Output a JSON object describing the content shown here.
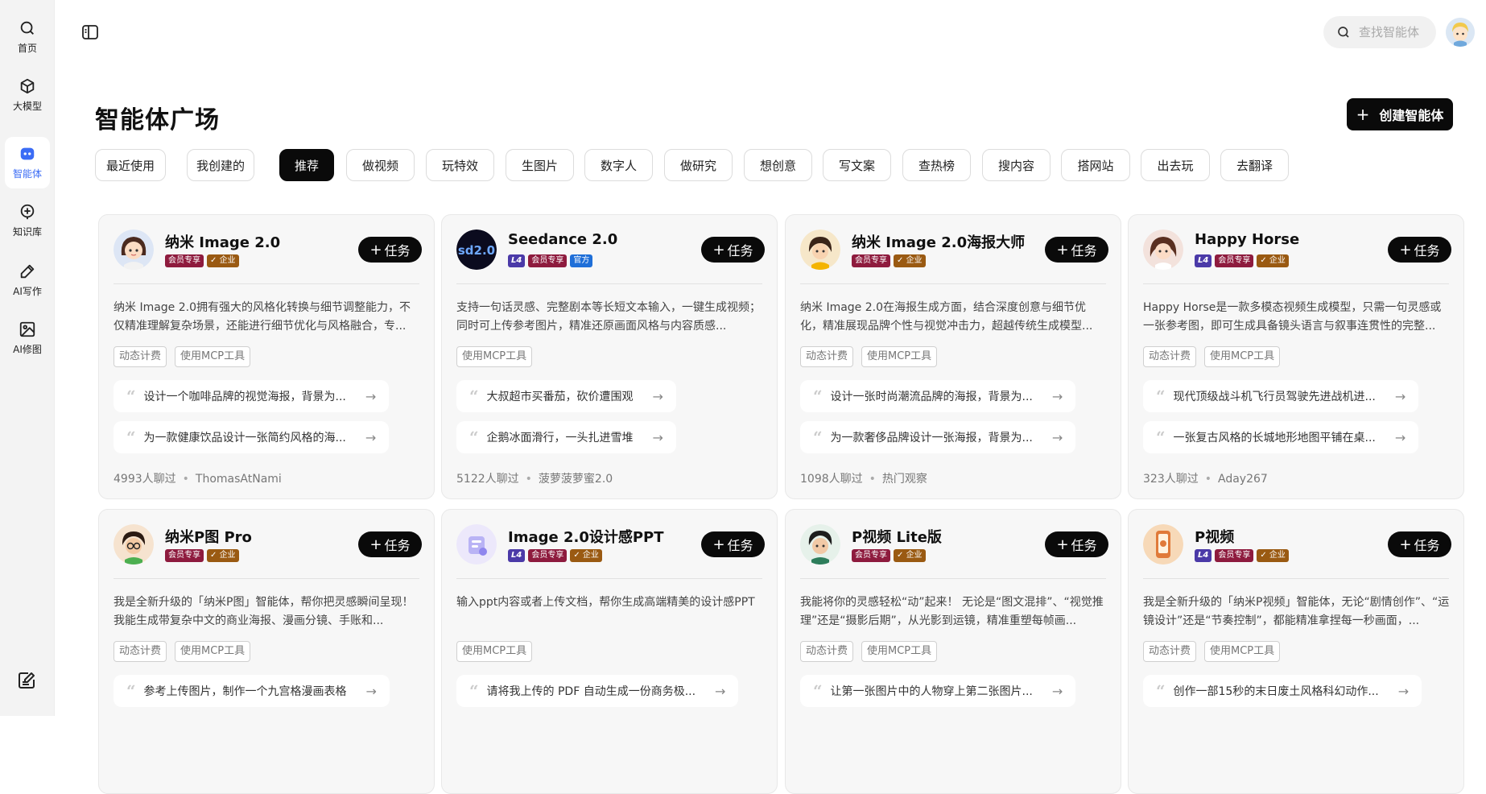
{
  "sidebar": {
    "items": [
      {
        "label": "首页",
        "icon": "search-icon"
      },
      {
        "label": "大模型",
        "icon": "cube-icon"
      },
      {
        "label": "智能体",
        "icon": "agent-icon"
      },
      {
        "label": "知识库",
        "icon": "add-circle-icon"
      },
      {
        "label": "AI写作",
        "icon": "pen-icon"
      },
      {
        "label": "AI修图",
        "icon": "image-icon"
      }
    ],
    "active_index": 2,
    "accent": "#3b6cf5"
  },
  "header": {
    "search_placeholder": "查找智能体"
  },
  "main": {
    "title": "智能体广场",
    "create_label": "创建智能体",
    "tabs": [
      "最近使用",
      "我创建的",
      "推荐",
      "做视频",
      "玩特效",
      "生图片",
      "数字人",
      "做研究",
      "想创意",
      "写文案",
      "查热榜",
      "搜内容",
      "搭网站",
      "出去玩",
      "去翻译"
    ],
    "active_tab": "推荐",
    "task_label": "任务",
    "cards": [
      {
        "name": "纳米 Image 2.0",
        "badges": [
          {
            "type": "vip",
            "text": "会员专享"
          },
          {
            "type": "ent",
            "text": "企业"
          }
        ],
        "desc": "纳米 Image 2.0拥有强大的风格化转换与细节调整能力，不仅精准理解复杂场景，还能进行细节优化与风格融合，专...",
        "tags": [
          "动态计费",
          "使用MCP工具"
        ],
        "prompts": [
          "设计一个咖啡品牌的视觉海报，背景为...",
          "为一款健康饮品设计一张简约风格的海..."
        ],
        "chats": "4993人聊过",
        "author": "ThomasAtNami"
      },
      {
        "name": "Seedance 2.0",
        "badges": [
          {
            "type": "l4",
            "text": "L4"
          },
          {
            "type": "vip",
            "text": "会员专享"
          },
          {
            "type": "off",
            "text": "官方"
          }
        ],
        "desc": "支持一句话灵感、完整剧本等长短文本输入，一键生成视频；同时可上传参考图片，精准还原画面风格与内容质感...",
        "tags": [
          "使用MCP工具"
        ],
        "prompts": [
          "大叔超市买番茄，砍价遭围观",
          "企鹅冰面滑行，一头扎进雪堆"
        ],
        "chats": "5122人聊过",
        "author": "菠萝菠萝蜜2.0"
      },
      {
        "name": "纳米 Image 2.0海报大师",
        "badges": [
          {
            "type": "vip",
            "text": "会员专享"
          },
          {
            "type": "ent",
            "text": "企业"
          }
        ],
        "desc": "纳米 Image 2.0在海报生成方面，结合深度创意与细节优化，精准展现品牌个性与视觉冲击力，超越传统生成模型...",
        "tags": [
          "动态计费",
          "使用MCP工具"
        ],
        "prompts": [
          "设计一张时尚潮流品牌的海报，背景为...",
          "为一款奢侈品牌设计一张海报，背景为..."
        ],
        "chats": "1098人聊过",
        "author": "热门观察"
      },
      {
        "name": "Happy Horse",
        "badges": [
          {
            "type": "l4",
            "text": "L4"
          },
          {
            "type": "vip",
            "text": "会员专享"
          },
          {
            "type": "ent",
            "text": "企业"
          }
        ],
        "desc": "Happy Horse是一款多模态视频生成模型，只需一句灵感或一张参考图，即可生成具备镜头语言与叙事连贯性的完整...",
        "tags": [
          "动态计费",
          "使用MCP工具"
        ],
        "prompts": [
          "现代顶级战斗机飞行员驾驶先进战机进...",
          "一张复古风格的长城地形地图平铺在桌..."
        ],
        "chats": "323人聊过",
        "author": "Aday267"
      },
      {
        "name": "纳米P图 Pro",
        "badges": [
          {
            "type": "vip",
            "text": "会员专享"
          },
          {
            "type": "ent",
            "text": "企业"
          }
        ],
        "desc": "我是全新升级的「纳米P图」智能体，帮你把灵感瞬间呈现！ 我能生成带复杂中文的商业海报、漫画分镜、手账和...",
        "tags": [
          "动态计费",
          "使用MCP工具"
        ],
        "prompts": [
          "参考上传图片，制作一个九宫格漫画表格"
        ],
        "chats": "",
        "author": ""
      },
      {
        "name": "Image 2.0设计感PPT",
        "badges": [
          {
            "type": "l4",
            "text": "L4"
          },
          {
            "type": "vip",
            "text": "会员专享"
          },
          {
            "type": "ent",
            "text": "企业"
          }
        ],
        "desc": "输入ppt内容或者上传文档，帮你生成高端精美的设计感PPT",
        "tags": [
          "使用MCP工具"
        ],
        "prompts": [
          "请将我上传的 PDF 自动生成一份商务极..."
        ],
        "chats": "",
        "author": ""
      },
      {
        "name": "P视频 Lite版",
        "badges": [
          {
            "type": "vip",
            "text": "会员专享"
          },
          {
            "type": "ent",
            "text": "企业"
          }
        ],
        "desc": "我能将你的灵感轻松“动”起来！ 无论是“图文混排”、“视觉推理”还是“摄影后期”，从光影到运镜，精准重塑每帧画...",
        "tags": [
          "动态计费",
          "使用MCP工具"
        ],
        "prompts": [
          "让第一张图片中的人物穿上第二张图片..."
        ],
        "chats": "",
        "author": ""
      },
      {
        "name": "P视频",
        "badges": [
          {
            "type": "l4",
            "text": "L4"
          },
          {
            "type": "vip",
            "text": "会员专享"
          },
          {
            "type": "ent",
            "text": "企业"
          }
        ],
        "desc": "我是全新升级的「纳米P视频」智能体，无论“剧情创作”、“运镜设计”还是“节奏控制”，都能精准拿捏每一秒画面，...",
        "tags": [
          "动态计费",
          "使用MCP工具"
        ],
        "prompts": [
          "创作一部15秒的末日废土风格科幻动作..."
        ],
        "chats": "",
        "author": ""
      }
    ]
  }
}
